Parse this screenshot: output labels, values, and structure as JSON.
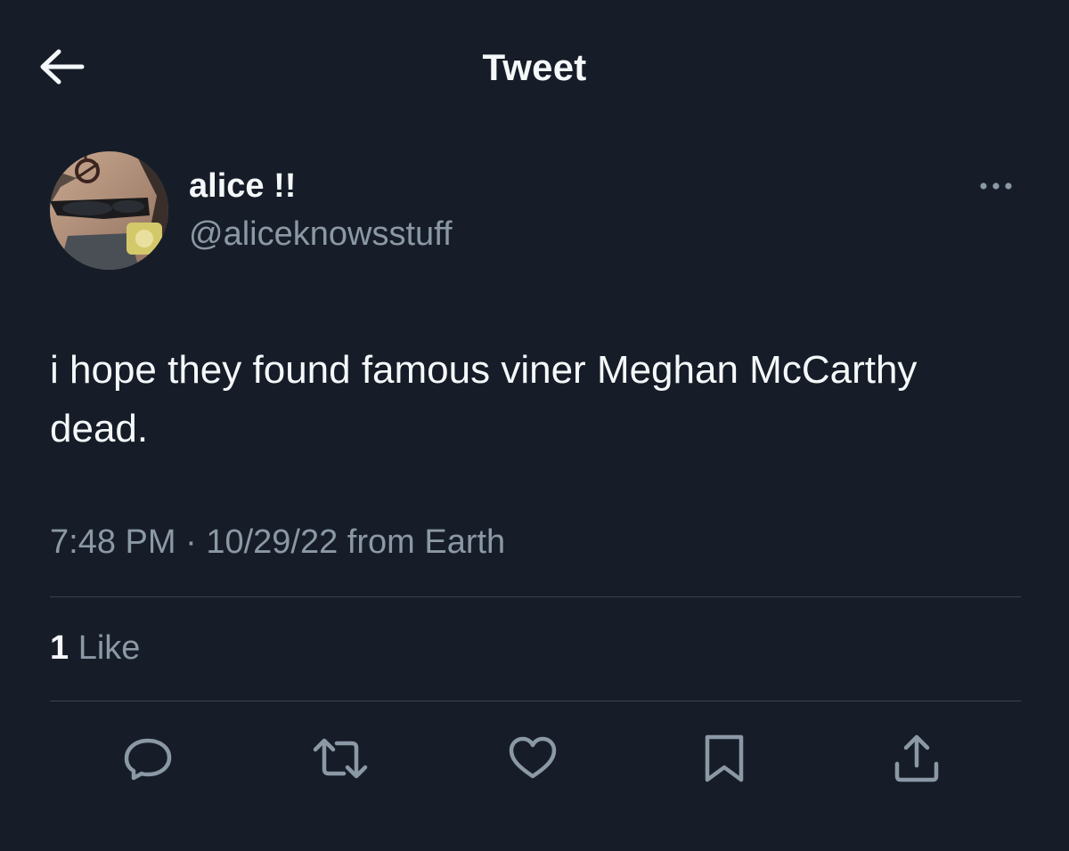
{
  "header": {
    "title": "Tweet",
    "back_icon": "arrow-left-icon"
  },
  "author": {
    "display_name": "alice !!",
    "handle": "@aliceknowsstuff",
    "avatar": "profile-photo"
  },
  "tweet": {
    "text": "i hope they found famous viner Meghan McCarthy dead.",
    "time": "7:48 PM",
    "separator": " · ",
    "date": "10/29/22",
    "source": " from Earth"
  },
  "stats": {
    "like_count": "1",
    "like_label": " Like"
  },
  "actions": [
    {
      "icon": "reply-icon"
    },
    {
      "icon": "retweet-icon"
    },
    {
      "icon": "like-icon"
    },
    {
      "icon": "bookmark-icon"
    },
    {
      "icon": "share-icon"
    }
  ],
  "colors": {
    "background": "#161d28",
    "text_primary": "#f5f8fa",
    "text_secondary": "#8b98a5",
    "divider": "#38444d"
  }
}
